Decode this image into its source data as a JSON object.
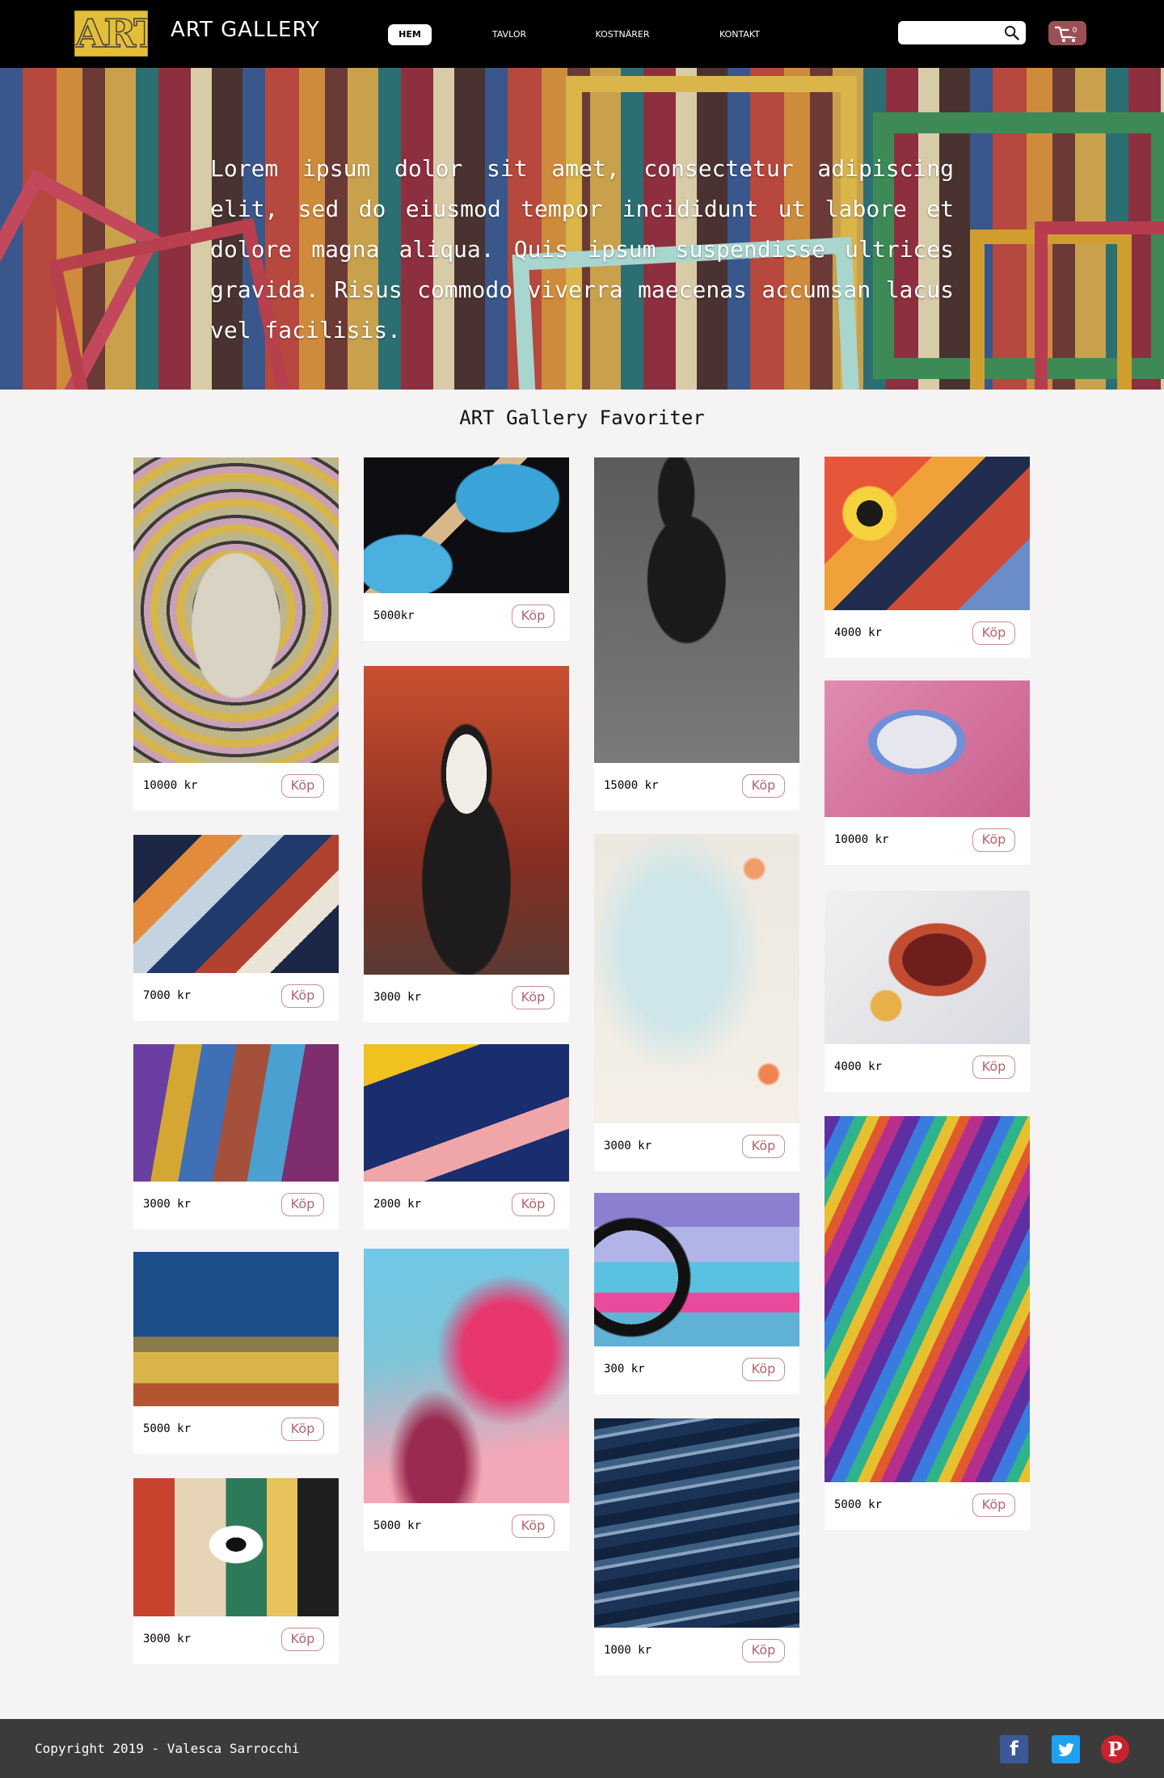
{
  "header": {
    "logo_text": "ART",
    "brand": "ART GALLERY",
    "nav": [
      "HEM",
      "TAVLOR",
      "KOSTNÄRER",
      "KONTAKT"
    ],
    "search": {
      "value": "",
      "placeholder": ""
    },
    "cart_count": "0"
  },
  "hero": {
    "text": "Lorem ipsum dolor sit amet, consectetur adipiscing elit, sed do eiusmod tempor incididunt ut labore et dolore magna aliqua. Quis ipsum suspendisse ultrices gravida. Risus commodo viverra maecenas accumsan lacus vel facilisis."
  },
  "gallery": {
    "title": "ART Gallery Favoriter",
    "buy_label": "Köp",
    "items": [
      {
        "price": "10000 kr"
      },
      {
        "price": "7000 kr"
      },
      {
        "price": "3000 kr"
      },
      {
        "price": "5000 kr"
      },
      {
        "price": "3000 kr"
      },
      {
        "price": "5000kr"
      },
      {
        "price": "3000 kr"
      },
      {
        "price": "2000 kr"
      },
      {
        "price": "5000 kr"
      },
      {
        "price": "15000 kr"
      },
      {
        "price": "3000 kr"
      },
      {
        "price": "300 kr"
      },
      {
        "price": "1000 kr"
      },
      {
        "price": "4000 kr"
      },
      {
        "price": "10000 kr"
      },
      {
        "price": "4000 kr"
      },
      {
        "price": "5000 kr"
      }
    ]
  },
  "footer": {
    "copyright": "Copyright 2019 - Valesca Sarrocchi",
    "social": [
      "facebook-icon",
      "twitter-icon",
      "pinterest-icon"
    ]
  },
  "colors": {
    "nav_bg": "#000000",
    "accent": "#9a5156",
    "buy_border": "#c78d93",
    "footer_bg": "#3b3b3b",
    "page_bg": "#f5f3f4"
  }
}
